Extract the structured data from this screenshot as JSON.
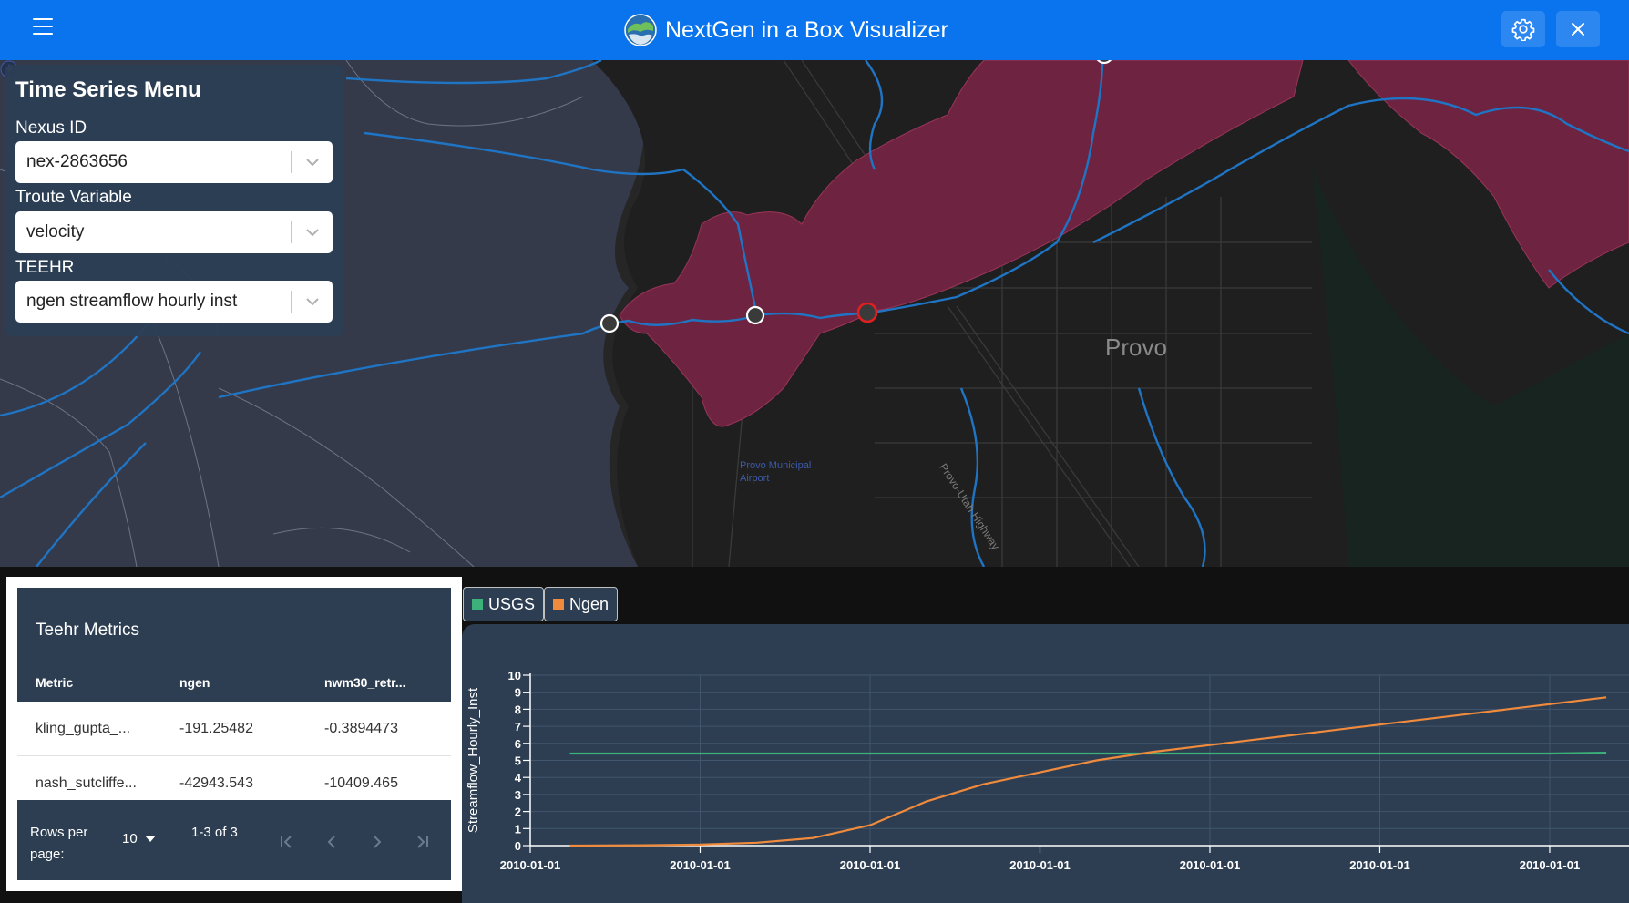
{
  "header": {
    "title": "NextGen in a Box Visualizer",
    "menu_icon": "hamburger-icon",
    "settings_icon": "gear-icon",
    "close_icon": "close-icon",
    "background": "#0a74ee"
  },
  "map": {
    "city_label": "Provo",
    "airport_label": "Provo Municipal\nAirport",
    "road_label": "Provo-Utah Highway",
    "selected_node_color": "#e02020"
  },
  "ts_menu": {
    "title": "Time Series Menu",
    "fields": [
      {
        "label": "Nexus ID",
        "value": "nex-2863656"
      },
      {
        "label": "Troute Variable",
        "value": "velocity"
      },
      {
        "label": "TEEHR",
        "value": "ngen streamflow hourly inst"
      }
    ]
  },
  "metrics": {
    "title": "Teehr Metrics",
    "columns": [
      "Metric",
      "ngen",
      "nwm30_retr..."
    ],
    "rows": [
      [
        "kling_gupta_...",
        "-191.25482",
        "-0.3894473"
      ],
      [
        "nash_sutcliffe...",
        "-42943.543",
        "-10409.465"
      ]
    ],
    "footer": {
      "rows_per_page_label": "Rows per page:",
      "rows_per_page_value": "10",
      "range_text": "1-3 of 3"
    }
  },
  "chart_data": {
    "type": "line",
    "ylabel": "Streamflow_Hourly_Inst",
    "xlabel": "",
    "ylim": [
      0,
      10
    ],
    "yticks": [
      "0",
      "1",
      "2",
      "3",
      "4",
      "5",
      "6",
      "7",
      "8",
      "9",
      "10"
    ],
    "xtick_labels": [
      "2010-01-01",
      "2010-01-01",
      "2010-01-01",
      "2010-01-01",
      "2010-01-01",
      "2010-01-01",
      "2010-01-01",
      "2010-01-01"
    ],
    "x": [
      0.35,
      1,
      1.5,
      2,
      2.5,
      3,
      3.5,
      4,
      4.5,
      5,
      5.5,
      6,
      6.5,
      7,
      7.5,
      8,
      8.5,
      9,
      9.5
    ],
    "series": [
      {
        "name": "USGS",
        "color": "#3cb27a",
        "values": [
          5.4,
          5.4,
          5.4,
          5.4,
          5.4,
          5.4,
          5.4,
          5.4,
          5.4,
          5.4,
          5.4,
          5.4,
          5.4,
          5.4,
          5.4,
          5.4,
          5.4,
          5.4,
          5.45
        ]
      },
      {
        "name": "Ngen",
        "color": "#f08a3c",
        "values": [
          0.0,
          0.02,
          0.06,
          0.17,
          0.45,
          1.2,
          2.6,
          3.6,
          4.3,
          5.0,
          5.5,
          5.9,
          6.3,
          6.7,
          7.1,
          7.5,
          7.9,
          8.3,
          8.7
        ]
      }
    ],
    "grid": true,
    "legend": "top-left"
  }
}
